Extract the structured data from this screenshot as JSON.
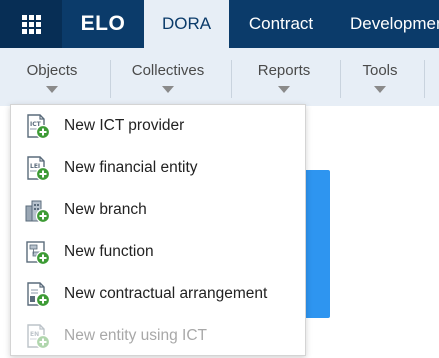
{
  "topbar": {
    "logo": "ELO",
    "tabs": [
      {
        "label": "DORA",
        "active": true
      },
      {
        "label": "Contract",
        "active": false
      },
      {
        "label": "Development",
        "active": false
      }
    ]
  },
  "ribbon": {
    "groups": [
      {
        "label": "Objects"
      },
      {
        "label": "Collectives"
      },
      {
        "label": "Reports"
      },
      {
        "label": "Tools"
      }
    ]
  },
  "menu": {
    "items": [
      {
        "label": "New ICT provider",
        "icon": "ict-provider-add-icon",
        "disabled": false
      },
      {
        "label": "New financial entity",
        "icon": "financial-entity-add-icon",
        "disabled": false
      },
      {
        "label": "New branch",
        "icon": "branch-add-icon",
        "disabled": false
      },
      {
        "label": "New function",
        "icon": "function-add-icon",
        "disabled": false
      },
      {
        "label": "New contractual arrangement",
        "icon": "contract-add-icon",
        "disabled": false
      },
      {
        "label": "New entity using ICT",
        "icon": "entity-ict-add-icon",
        "disabled": true
      }
    ]
  },
  "colors": {
    "topbar": "#0b3b6a",
    "apps_button": "#072e55",
    "ribbon": "#e7eef6",
    "accent_panel": "#2e95f0",
    "plus_badge": "#3d9b35"
  }
}
